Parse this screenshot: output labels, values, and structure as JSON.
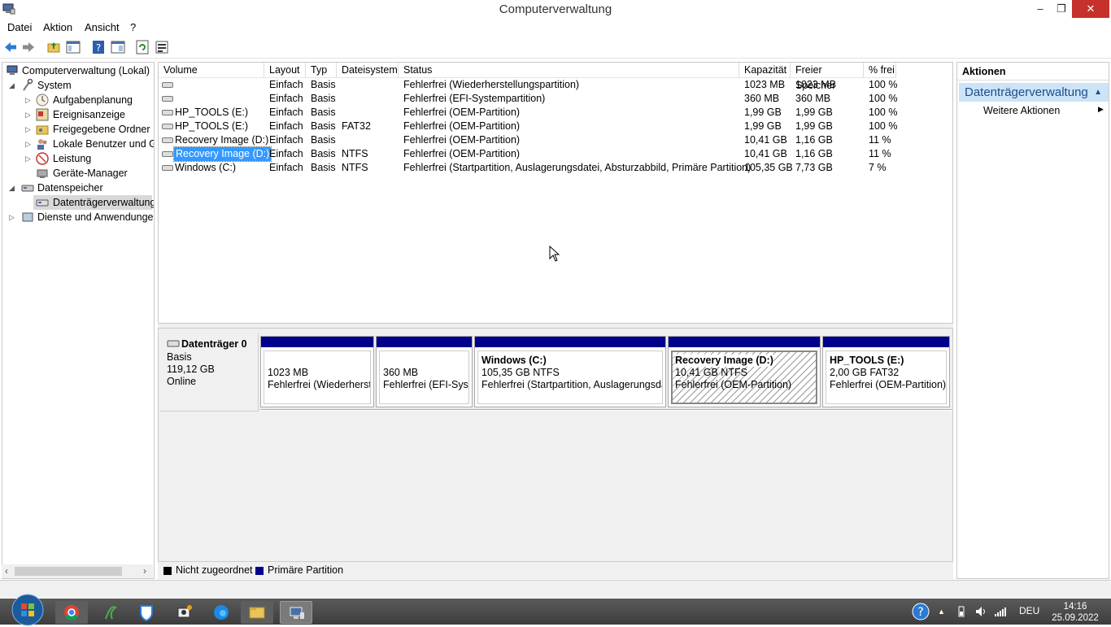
{
  "window": {
    "title": "Computerverwaltung",
    "minimize": "–",
    "maximize": "❐",
    "close": "✕"
  },
  "menu": [
    "Datei",
    "Aktion",
    "Ansicht",
    "?"
  ],
  "tree": [
    {
      "label": "Computerverwaltung (Lokal)"
    },
    {
      "label": "System"
    },
    {
      "label": "Aufgabenplanung"
    },
    {
      "label": "Ereignisanzeige"
    },
    {
      "label": "Freigegebene Ordner"
    },
    {
      "label": "Lokale Benutzer und Gruppen"
    },
    {
      "label": "Leistung"
    },
    {
      "label": "Geräte-Manager"
    },
    {
      "label": "Datenspeicher"
    },
    {
      "label": "Datenträgerverwaltung"
    },
    {
      "label": "Dienste und Anwendungen"
    }
  ],
  "columns": [
    "Volume",
    "Layout",
    "Typ",
    "Dateisystem",
    "Status",
    "Kapazität",
    "Freier Speicher",
    "% frei"
  ],
  "volumes": [
    {
      "volume": "",
      "layout": "Einfach",
      "type": "Basis",
      "fs": "",
      "status": "Fehlerfrei (Wiederherstellungspartition)",
      "capacity": "1023 MB",
      "free": "1023 MB",
      "pct": "100 %"
    },
    {
      "volume": "",
      "layout": "Einfach",
      "type": "Basis",
      "fs": "",
      "status": "Fehlerfrei (EFI-Systempartition)",
      "capacity": "360 MB",
      "free": "360 MB",
      "pct": "100 %"
    },
    {
      "volume": "HP_TOOLS (E:)",
      "layout": "Einfach",
      "type": "Basis",
      "fs": "",
      "status": "Fehlerfrei (OEM-Partition)",
      "capacity": "1,99 GB",
      "free": "1,99 GB",
      "pct": "100 %"
    },
    {
      "volume": "HP_TOOLS (E:)",
      "layout": "Einfach",
      "type": "Basis",
      "fs": "FAT32",
      "status": "Fehlerfrei (OEM-Partition)",
      "capacity": "1,99 GB",
      "free": "1,99 GB",
      "pct": "100 %"
    },
    {
      "volume": "Recovery Image (D:)",
      "layout": "Einfach",
      "type": "Basis",
      "fs": "",
      "status": "Fehlerfrei (OEM-Partition)",
      "capacity": "10,41 GB",
      "free": "1,16 GB",
      "pct": "11 %"
    },
    {
      "volume": "Recovery Image (D:)",
      "layout": "Einfach",
      "type": "Basis",
      "fs": "NTFS",
      "status": "Fehlerfrei (OEM-Partition)",
      "capacity": "10,41 GB",
      "free": "1,16 GB",
      "pct": "11 %"
    },
    {
      "volume": "Windows (C:)",
      "layout": "Einfach",
      "type": "Basis",
      "fs": "NTFS",
      "status": "Fehlerfrei (Startpartition, Auslagerungsdatei, Absturzabbild, Primäre Partition)",
      "capacity": "105,35 GB",
      "free": "7,73 GB",
      "pct": "7 %"
    }
  ],
  "disk": {
    "name": "Datenträger 0",
    "type": "Basis",
    "size": "119,12 GB",
    "state": "Online"
  },
  "partitions": [
    {
      "name": "",
      "size": "1023 MB",
      "status": "Fehlerfrei (Wiederherstellungspartition)"
    },
    {
      "name": "",
      "size": "360 MB",
      "status": "Fehlerfrei (EFI-Systempartition)"
    },
    {
      "name": "Windows  (C:)",
      "size": "105,35 GB NTFS",
      "status": "Fehlerfrei (Startpartition, Auslagerungsdatei, Absturzabbild)"
    },
    {
      "name": "Recovery Image  (D:)",
      "size": "10,41 GB NTFS",
      "status": "Fehlerfrei (OEM-Partition)"
    },
    {
      "name": "HP_TOOLS  (E:)",
      "size": "2,00 GB FAT32",
      "status": "Fehlerfrei (OEM-Partition)"
    }
  ],
  "legend": [
    {
      "label": "Nicht zugeordnet",
      "color": "#000000"
    },
    {
      "label": "Primäre Partition",
      "color": "#00008b"
    }
  ],
  "actions": {
    "header": "Aktionen",
    "section": "Datenträgerverwaltung",
    "item": "Weitere Aktionen"
  },
  "taskbar": {
    "language": "DEU",
    "time": "14:16",
    "date": "25.09.2022"
  }
}
